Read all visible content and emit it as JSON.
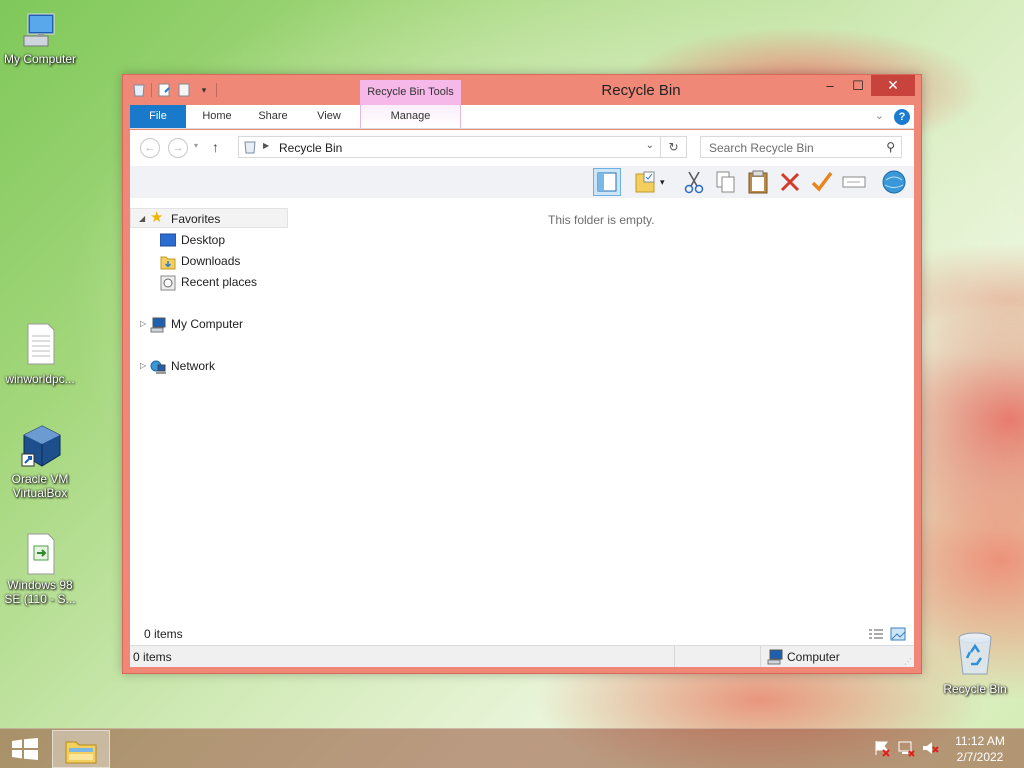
{
  "desktop": {
    "icons": [
      {
        "label": "My Computer"
      },
      {
        "label": "winworldpc..."
      },
      {
        "label": "Oracle VM VirtualBox"
      },
      {
        "label": "Windows 98 SE (110 - S..."
      },
      {
        "label": "Recycle Bin"
      }
    ]
  },
  "window": {
    "title": "Recycle Bin",
    "contextual_tab_header": "Recycle Bin Tools",
    "controls": {
      "minimize": "‒",
      "maximize": "☐",
      "close": "✕"
    },
    "ribbon_tabs": [
      "File",
      "Home",
      "Share",
      "View",
      "Manage"
    ],
    "help": "?",
    "address": {
      "path": "Recycle Bin"
    },
    "search": {
      "placeholder": "Search Recycle Bin"
    },
    "nav_pane": {
      "favorites": "Favorites",
      "desktop": "Desktop",
      "downloads": "Downloads",
      "recent_places": "Recent places",
      "my_computer": "My Computer",
      "network": "Network"
    },
    "empty_message": "This folder is empty.",
    "items_count": "0 items",
    "status": {
      "items": "0 items",
      "location": "Computer"
    }
  },
  "taskbar": {
    "time": "11:12 AM",
    "date": "2/7/2022"
  },
  "colors": {
    "window_frame": "#f08878",
    "close_button": "#c7433c",
    "file_tab": "#1979ca",
    "context_tab": "#f5b8e8"
  }
}
